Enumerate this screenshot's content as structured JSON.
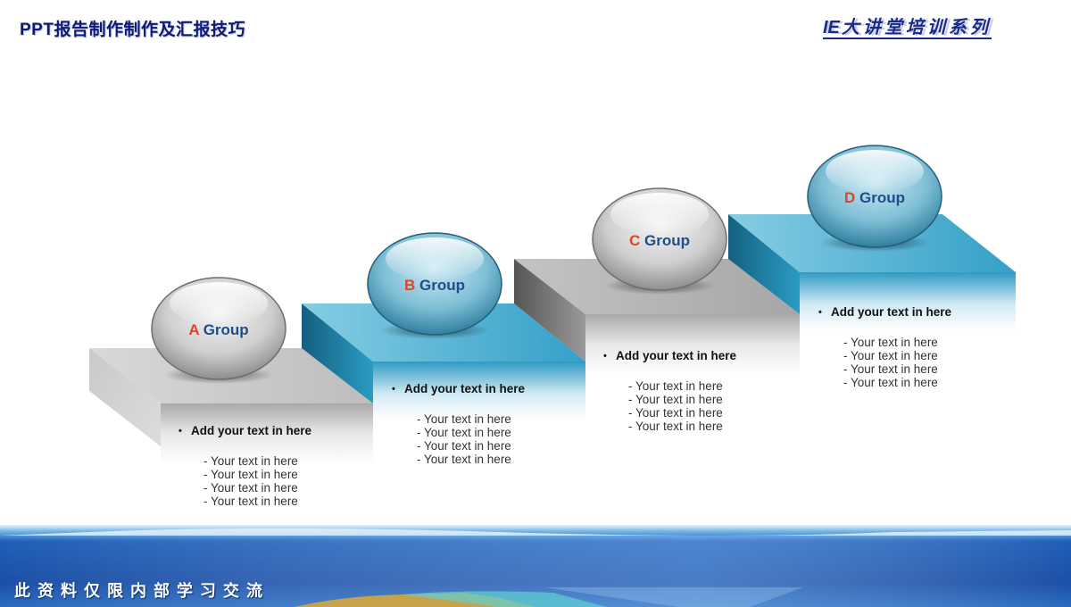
{
  "header": {
    "title": "PPT报告制作制作及汇报技巧",
    "brand_prefix": "IE",
    "brand_rest": "大讲堂培训系列"
  },
  "footer": {
    "notice": "此资料仅限内部学习交流"
  },
  "colors": {
    "letter_accent": "#d9462a",
    "group_text": "#1f4e8c",
    "blue_step": "#3aa6cc",
    "gray_step": "#c8c8c8",
    "title_color": "#0d1a7a"
  },
  "steps": [
    {
      "letter": "A",
      "word": "Group",
      "style": "gray",
      "heading": "Add your text in here",
      "items": [
        "- Your text in here",
        "- Your text in here",
        "- Your text in here",
        "- Your text in here"
      ]
    },
    {
      "letter": "B",
      "word": "Group",
      "style": "blue",
      "heading": "Add your text in here",
      "items": [
        "- Your text in here",
        "- Your text in here",
        "- Your text in here",
        "- Your text in here"
      ]
    },
    {
      "letter": "C",
      "word": "Group",
      "style": "gray",
      "heading": "Add your text in here",
      "items": [
        "- Your text in here",
        "- Your text in here",
        "- Your text in here",
        "- Your text in here"
      ]
    },
    {
      "letter": "D",
      "word": "Group",
      "style": "blue",
      "heading": "Add your text in here",
      "items": [
        "- Your text in here",
        "- Your text in here",
        "- Your text in here",
        "- Your text in here"
      ]
    }
  ]
}
